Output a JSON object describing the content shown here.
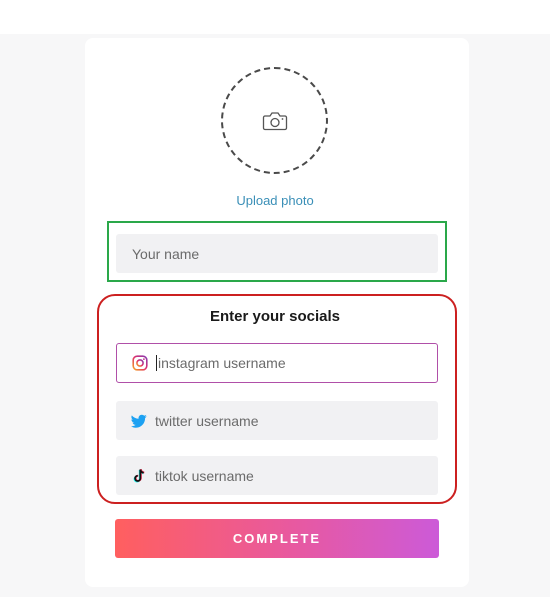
{
  "profile": {
    "upload_label": "Upload photo",
    "camera_icon": "camera-icon"
  },
  "name_field": {
    "placeholder": "Your name",
    "value": ""
  },
  "socials": {
    "title": "Enter your socials",
    "instagram": {
      "icon": "instagram-icon",
      "placeholder": "instagram username",
      "value": "",
      "focused": true
    },
    "twitter": {
      "icon": "twitter-icon",
      "placeholder": "twitter username",
      "value": ""
    },
    "tiktok": {
      "icon": "tiktok-icon",
      "placeholder": "tiktok username",
      "value": ""
    }
  },
  "complete_button": {
    "label": "COMPLETE"
  },
  "colors": {
    "accent_link": "#3a8fb7",
    "highlight_green": "#2aa84a",
    "highlight_red": "#cc2020",
    "focus_border": "#b04fa8",
    "button_gradient_start": "#ff5f5f",
    "button_gradient_end": "#cc5ad8",
    "twitter_blue": "#1da1f2"
  }
}
